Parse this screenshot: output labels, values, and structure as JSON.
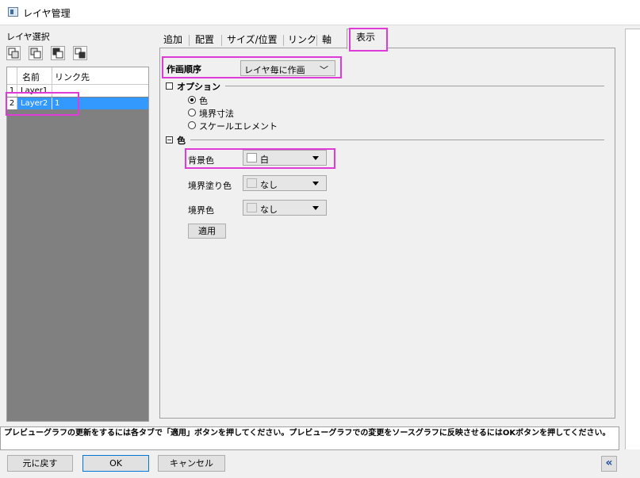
{
  "window": {
    "title": "レイヤ管理"
  },
  "layer_select": {
    "label": "レイヤ選択",
    "tools": [
      "add-layer-icon",
      "insert-layer-icon",
      "duplicate-layer-icon",
      "arrange-layer-icon"
    ],
    "columns": {
      "name": "名前",
      "link": "リンク先"
    },
    "rows": [
      {
        "index": "1",
        "name": "Layer1",
        "link": ""
      },
      {
        "index": "2",
        "name": "Layer2",
        "link": "1"
      }
    ]
  },
  "tabs": [
    "追加",
    "配置",
    "サイズ/位置",
    "リンク",
    "軸",
    "表示"
  ],
  "display_tab": {
    "draw_order": {
      "label": "作画順序",
      "value": "レイヤ毎に作画"
    },
    "options": {
      "title": "オプション",
      "radios": [
        "色",
        "境界寸法",
        "スケールエレメント"
      ]
    },
    "color": {
      "title": "色",
      "background": {
        "label": "背景色",
        "value": "白"
      },
      "border_fill": {
        "label": "境界塗り色",
        "value": "なし"
      },
      "border": {
        "label": "境界色",
        "value": "なし"
      },
      "apply": "適用"
    }
  },
  "message": "プレビューグラフの更新をするには各タブで「適用」ボタンを押してください。プレビューグラフでの変更をソースグラフに反映させるにはOKボタンを押してください。",
  "buttons": {
    "revert": "元に戻す",
    "ok": "OK",
    "cancel": "キャンセル",
    "collapse": "«"
  },
  "colors": {
    "selection": "#3399ff",
    "highlight": "#e03ad8",
    "list_bg": "#808080"
  }
}
